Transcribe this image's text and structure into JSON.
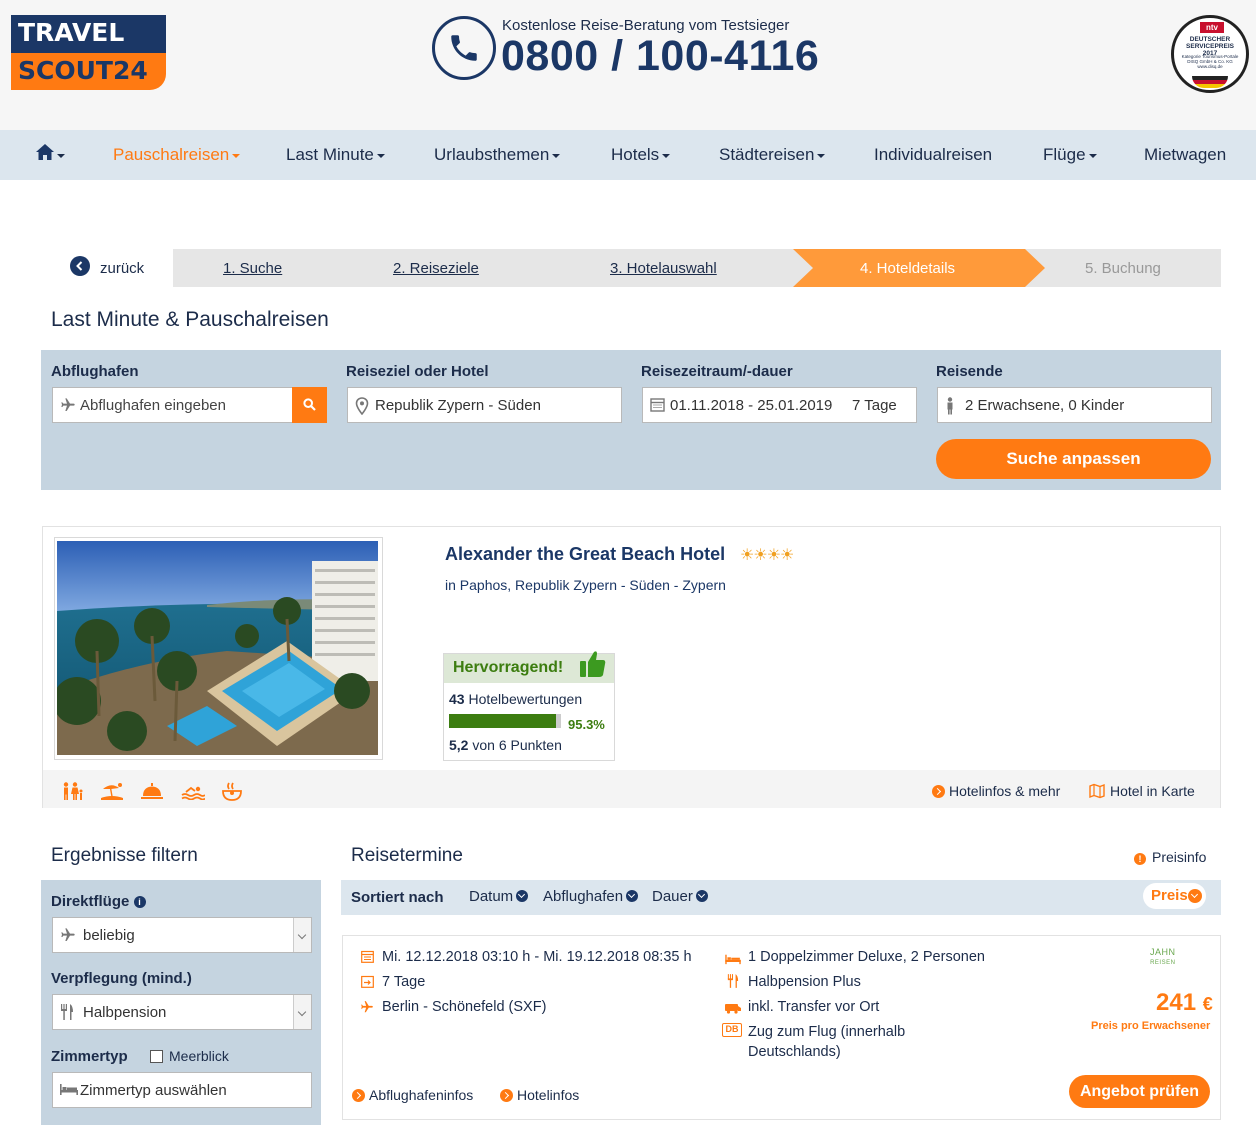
{
  "brand": {
    "logo_line1": "TRAVEL",
    "logo_line2": "SCOUT24",
    "phone_subtitle": "Kostenlose Reise-Beratung vom Testsieger",
    "phone_number": "0800 / 100-4116",
    "seal_badge": "ntv",
    "seal_title": "DEUTSCHER SERVICEPREIS 2017",
    "seal_category": "Kategorie Tourismus-Portale",
    "seal_text": "DISQ GmbH & Co. KG www.disq.de"
  },
  "nav": {
    "home_icon": "home-icon",
    "items": [
      {
        "label": "Pauschalreisen",
        "caret": true
      },
      {
        "label": "Last Minute",
        "caret": true
      },
      {
        "label": "Urlaubsthemen",
        "caret": true
      },
      {
        "label": "Hotels",
        "caret": true
      },
      {
        "label": "Städtereisen",
        "caret": true
      },
      {
        "label": "Individualreisen",
        "caret": false
      },
      {
        "label": "Flüge",
        "caret": true
      },
      {
        "label": "Mietwagen",
        "caret": false
      }
    ]
  },
  "steps": {
    "back": "zurück",
    "items": [
      "1. Suche",
      "2. Reiseziele",
      "3. Hotelauswahl",
      "4. Hoteldetails",
      "5. Buchung"
    ],
    "active_index": 3
  },
  "page_title": "Last Minute & Pauschalreisen",
  "search": {
    "airport_label": "Abflughafen",
    "airport_placeholder": "Abflughafen eingeben",
    "destination_label": "Reiseziel oder Hotel",
    "destination_value": "Republik Zypern - Süden",
    "period_label": "Reisezeitraum/-dauer",
    "period_value": "01.11.2018 - 25.01.2019",
    "duration_value": "7 Tage",
    "travellers_label": "Reisende",
    "travellers_value": "2 Erwachsene, 0 Kinder",
    "submit": "Suche anpassen"
  },
  "hotel": {
    "name": "Alexander the Great Beach Hotel",
    "stars": 4,
    "stars_text": "☀☀☀☀",
    "location": "in Paphos, Republik Zypern - Süden - Zypern",
    "rating_word": "Hervorragend!",
    "review_count": "43",
    "review_label": "Hotelbewertungen",
    "recommend_pct": 95.3,
    "recommend_pct_text": "95.3%",
    "score": "5,2",
    "score_suffix": "von 6 Punkten",
    "amenities": [
      "family-icon",
      "beach-icon",
      "service-bell-icon",
      "swimming-icon",
      "spa-icon"
    ],
    "link_info": "Hotelinfos & mehr",
    "link_map": "Hotel in Karte"
  },
  "filter": {
    "title": "Ergebnisse filtern",
    "direct_label": "Direktflüge",
    "direct_value": "beliebig",
    "board_label": "Verpflegung (mind.)",
    "board_value": "Halbpension",
    "room_label": "Zimmertyp",
    "seaview_label": "Meerblick",
    "seaview_checked": false,
    "room_placeholder": "Zimmertyp auswählen"
  },
  "results": {
    "title": "Reisetermine",
    "price_info": "Preisinfo",
    "sort_label": "Sortiert nach",
    "sort_options": [
      "Datum",
      "Abflughafen",
      "Dauer"
    ],
    "sort_active": "Preis",
    "offer": {
      "dates": "Mi. 12.12.2018 03:10 h - Mi. 19.12.2018 08:35 h",
      "duration": "7 Tage",
      "airport": "Berlin - Schönefeld (SXF)",
      "room": "1 Doppelzimmer Deluxe, 2 Personen",
      "board": "Halbpension Plus",
      "transfer": "inkl. Transfer vor Ort",
      "rail_badge": "DB",
      "rail_line1": "Zug zum Flug (innerhalb",
      "rail_line2": "Deutschlands)",
      "operator_line1": "JAHN",
      "operator_line2": "REISEN",
      "price": "241",
      "currency": "€",
      "price_note": "Preis pro Erwachsener",
      "link_airport": "Abflughafeninfos",
      "link_hotel": "Hotelinfos",
      "cta": "Angebot prüfen"
    }
  },
  "colors": {
    "brand_blue": "#1b3766",
    "accent_orange": "#ff7a12",
    "panel_blue": "#c5d4e0",
    "rating_green": "#3c7d10"
  }
}
